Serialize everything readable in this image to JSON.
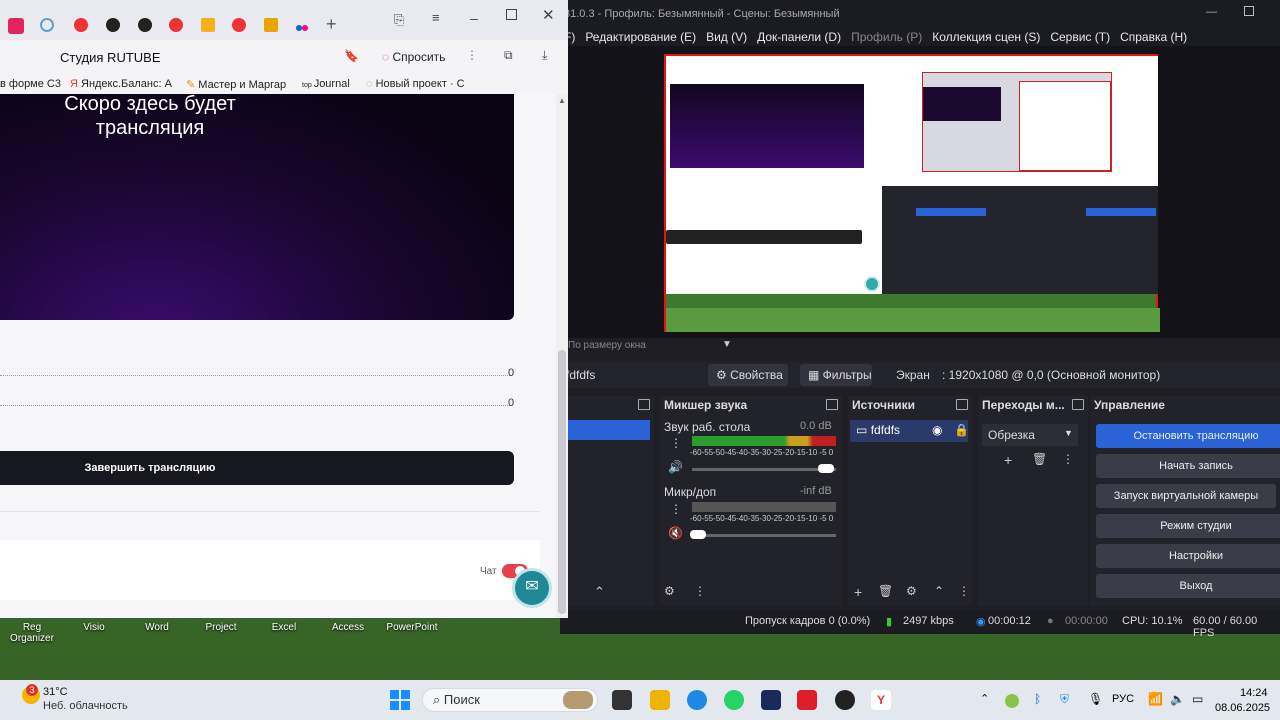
{
  "desktop": {
    "icons": [
      "Reg\nOrganizer",
      "Visio",
      "Word",
      "Project",
      "Excel",
      "Access",
      "PowerPoint"
    ]
  },
  "browser": {
    "tab_title": "Студия RUTUBE",
    "ask_label": "Спросить",
    "bookmarks": [
      "в форме С3",
      "Яндекс.Баланс: А",
      "Мастер и Маргар",
      "Journal",
      "Новый проект · С"
    ],
    "video_text_line1": "Скоро здесь будет",
    "video_text_line2": "трансляция",
    "stat_values": [
      "0",
      "0"
    ],
    "end_stream_label": "Завершить трансляцию",
    "chat_label": "Чат"
  },
  "obs": {
    "title": "31.0.3 - Профиль: Безымянный - Сцены: Безымянный",
    "menu": [
      "Редактирование (E)",
      "Вид (V)",
      "Док-панели (D)",
      "Профиль (P)",
      "Коллекция сцен (S)",
      "Сервис (T)",
      "Справка (H)"
    ],
    "menu_partial": "F)",
    "scale_label": "По размеру окна",
    "source_name": "fdfdfs",
    "properties_label": "Свойства",
    "filters_label": "Фильтры",
    "screen_label": "Экран",
    "screen_value": ": 1920x1080 @ 0,0 (Основной монитор)",
    "mixer_title": "Микшер звука",
    "mixer_channels": [
      {
        "name": "Звук раб. стола",
        "db": "0.0 dB"
      },
      {
        "name": "Микр/доп",
        "db": "-inf dB"
      }
    ],
    "meter_scale": "-60-55-50-45-40-35-30-25-20-15-10 -5 0",
    "sources_title": "Источники",
    "source_item": "fdfdfs",
    "transitions_title": "Переходы м...",
    "transition_value": "Обрезка",
    "controls_title": "Управление",
    "controls": [
      "Остановить трансляцию",
      "Начать запись",
      "Запуск виртуальной камеры",
      "Режим студии",
      "Настройки",
      "Выход"
    ],
    "status": {
      "dropped": "Пропуск кадров 0 (0.0%)",
      "bitrate": "2497 kbps",
      "stream_time": "00:00:12",
      "rec_time": "00:00:00",
      "cpu": "CPU: 10.1%",
      "fps": "60.00 / 60.00 FPS"
    }
  },
  "taskbar": {
    "weather_temp": "31°C",
    "weather_desc": "Неб. облачность",
    "badge": "3",
    "search_placeholder": "Поиск",
    "lang": "РУС",
    "time": "14:24",
    "date": "08.06.2025"
  },
  "colors": {
    "obs_accent": "#2a62d8",
    "rec_red": "#d22",
    "video_purple": "#2a0a52"
  }
}
